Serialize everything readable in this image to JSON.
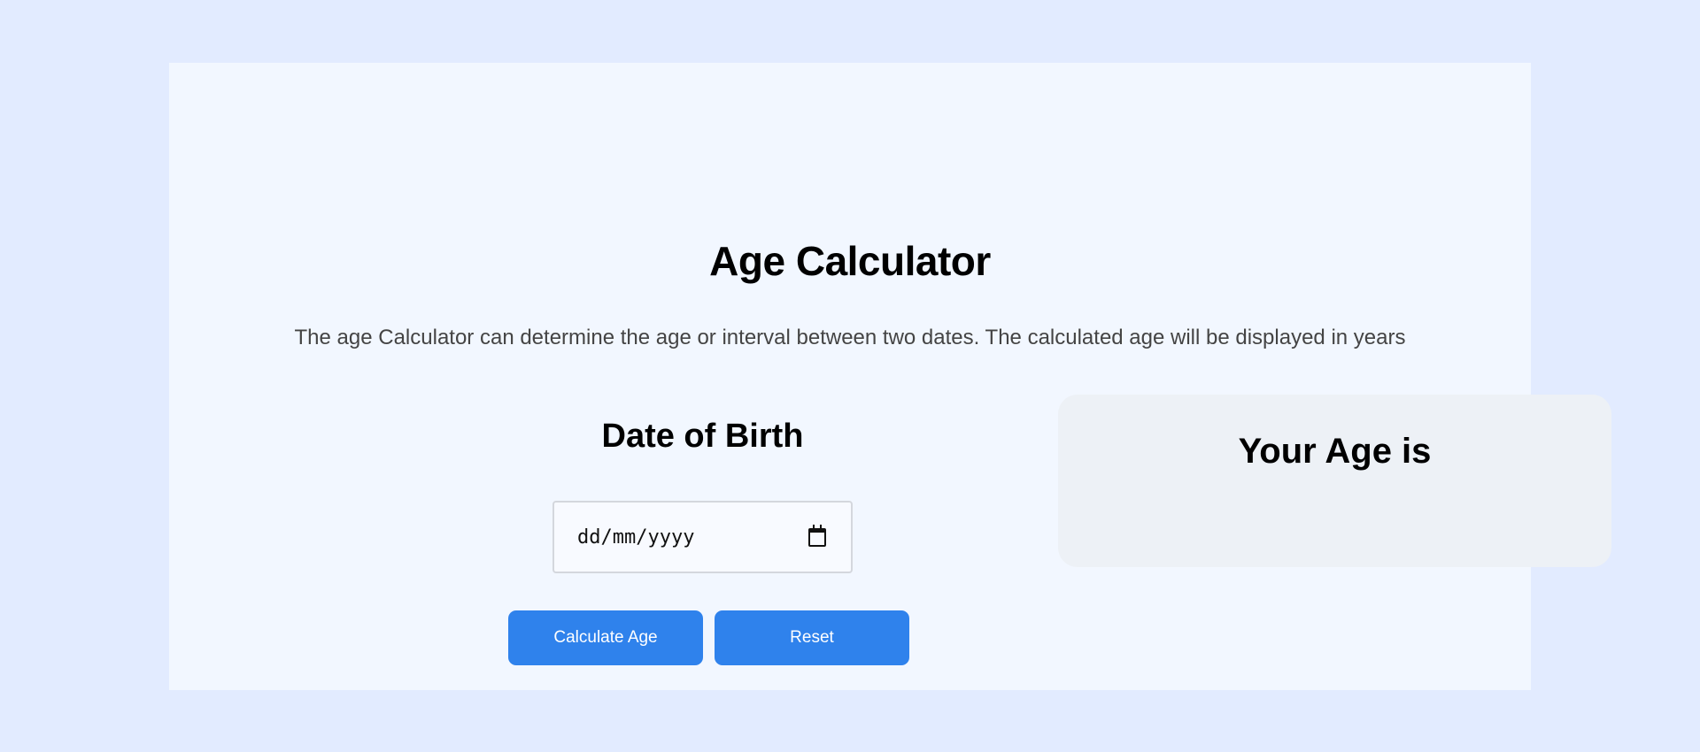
{
  "page": {
    "title": "Age Calculator",
    "subtitle": "The age Calculator can determine the age or interval between two dates. The calculated age will be displayed in years"
  },
  "dob_section": {
    "heading": "Date of Birth",
    "date_placeholder": "dd/mm/yyyy",
    "date_value": "",
    "calendar_icon": "calendar-icon"
  },
  "buttons": {
    "calculate_label": "Calculate Age",
    "reset_label": "Reset"
  },
  "result_panel": {
    "heading": "Your Age is",
    "result": ""
  },
  "colors": {
    "page_background": "#e2ebff",
    "card_background": "#f2f7ff",
    "result_panel_background": "#edf1f6",
    "button_accent": "#2f82ec",
    "button_text": "#ffffff"
  }
}
